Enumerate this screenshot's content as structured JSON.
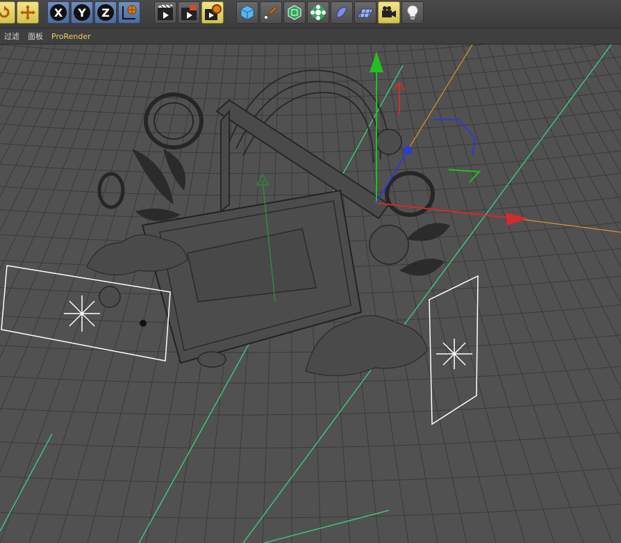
{
  "toolbar": {
    "icons": [
      "rotate-icon",
      "move-icon",
      "x-axis-icon",
      "y-axis-icon",
      "z-axis-icon",
      "world-coordinates-icon",
      "render-view-icon",
      "render-picture-viewer-icon",
      "render-settings-icon",
      "cube-icon",
      "pen-icon",
      "subdivision-icon",
      "cloner-icon",
      "deformer-icon",
      "floor-icon",
      "camera-icon",
      "light-icon"
    ],
    "axis_x": "X",
    "axis_y": "Y",
    "axis_z": "Z"
  },
  "menubar": {
    "items": [
      "过滤",
      "面板",
      "ProRender"
    ]
  },
  "viewport": {
    "colors": {
      "background": "#515151",
      "grid": "#3a3a3a",
      "wire": "#2a2a2a",
      "light_outline": "#ffffff",
      "guide_green": "#3ec47a",
      "axis_x": "#d32b2b",
      "axis_y": "#22c022",
      "axis_z": "#2b3cd3",
      "camera_line": "#e0902a"
    }
  }
}
